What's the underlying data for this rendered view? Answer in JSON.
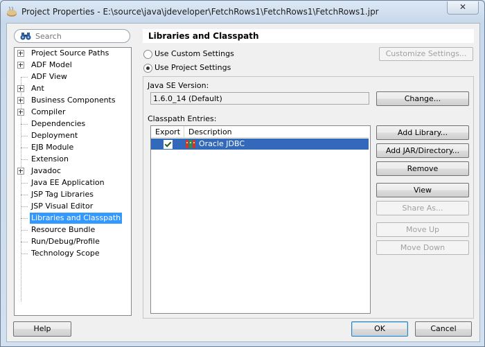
{
  "window": {
    "title": "Project Properties - E:\\source\\java\\jdeveloper\\FetchRows1\\FetchRows1\\FetchRows1.jpr",
    "close_label": "✕"
  },
  "search": {
    "placeholder": "Search"
  },
  "tree": {
    "items": [
      {
        "label": "Project Source Paths",
        "expandable": true
      },
      {
        "label": "ADF Model",
        "expandable": true
      },
      {
        "label": "ADF View",
        "expandable": false
      },
      {
        "label": "Ant",
        "expandable": true
      },
      {
        "label": "Business Components",
        "expandable": true
      },
      {
        "label": "Compiler",
        "expandable": true
      },
      {
        "label": "Dependencies",
        "expandable": false
      },
      {
        "label": "Deployment",
        "expandable": false
      },
      {
        "label": "EJB Module",
        "expandable": false
      },
      {
        "label": "Extension",
        "expandable": false
      },
      {
        "label": "Javadoc",
        "expandable": true
      },
      {
        "label": "Java EE Application",
        "expandable": false
      },
      {
        "label": "JSP Tag Libraries",
        "expandable": false
      },
      {
        "label": "JSP Visual Editor",
        "expandable": false
      },
      {
        "label": "Libraries and Classpath",
        "expandable": false,
        "selected": true
      },
      {
        "label": "Resource Bundle",
        "expandable": false
      },
      {
        "label": "Run/Debug/Profile",
        "expandable": false
      },
      {
        "label": "Technology Scope",
        "expandable": false
      }
    ]
  },
  "panel": {
    "title": "Libraries and Classpath",
    "use_custom_label": "Use Custom Settings",
    "use_project_label": "Use Project Settings",
    "customize_label": "Customize Settings...",
    "java_se_label": "Java SE Version:",
    "java_se_value": "1.6.0_14 (Default)",
    "change_label": "Change...",
    "classpath_label": "Classpath Entries:",
    "columns": [
      "Export",
      "Description"
    ],
    "entries": [
      {
        "export": true,
        "description": "Oracle JDBC"
      }
    ],
    "buttons": {
      "add_library": "Add Library...",
      "add_jar": "Add JAR/Directory...",
      "remove": "Remove",
      "view": "View",
      "share_as": "Share As...",
      "move_up": "Move Up",
      "move_down": "Move Down"
    }
  },
  "footer": {
    "help": "Help",
    "ok": "OK",
    "cancel": "Cancel"
  }
}
